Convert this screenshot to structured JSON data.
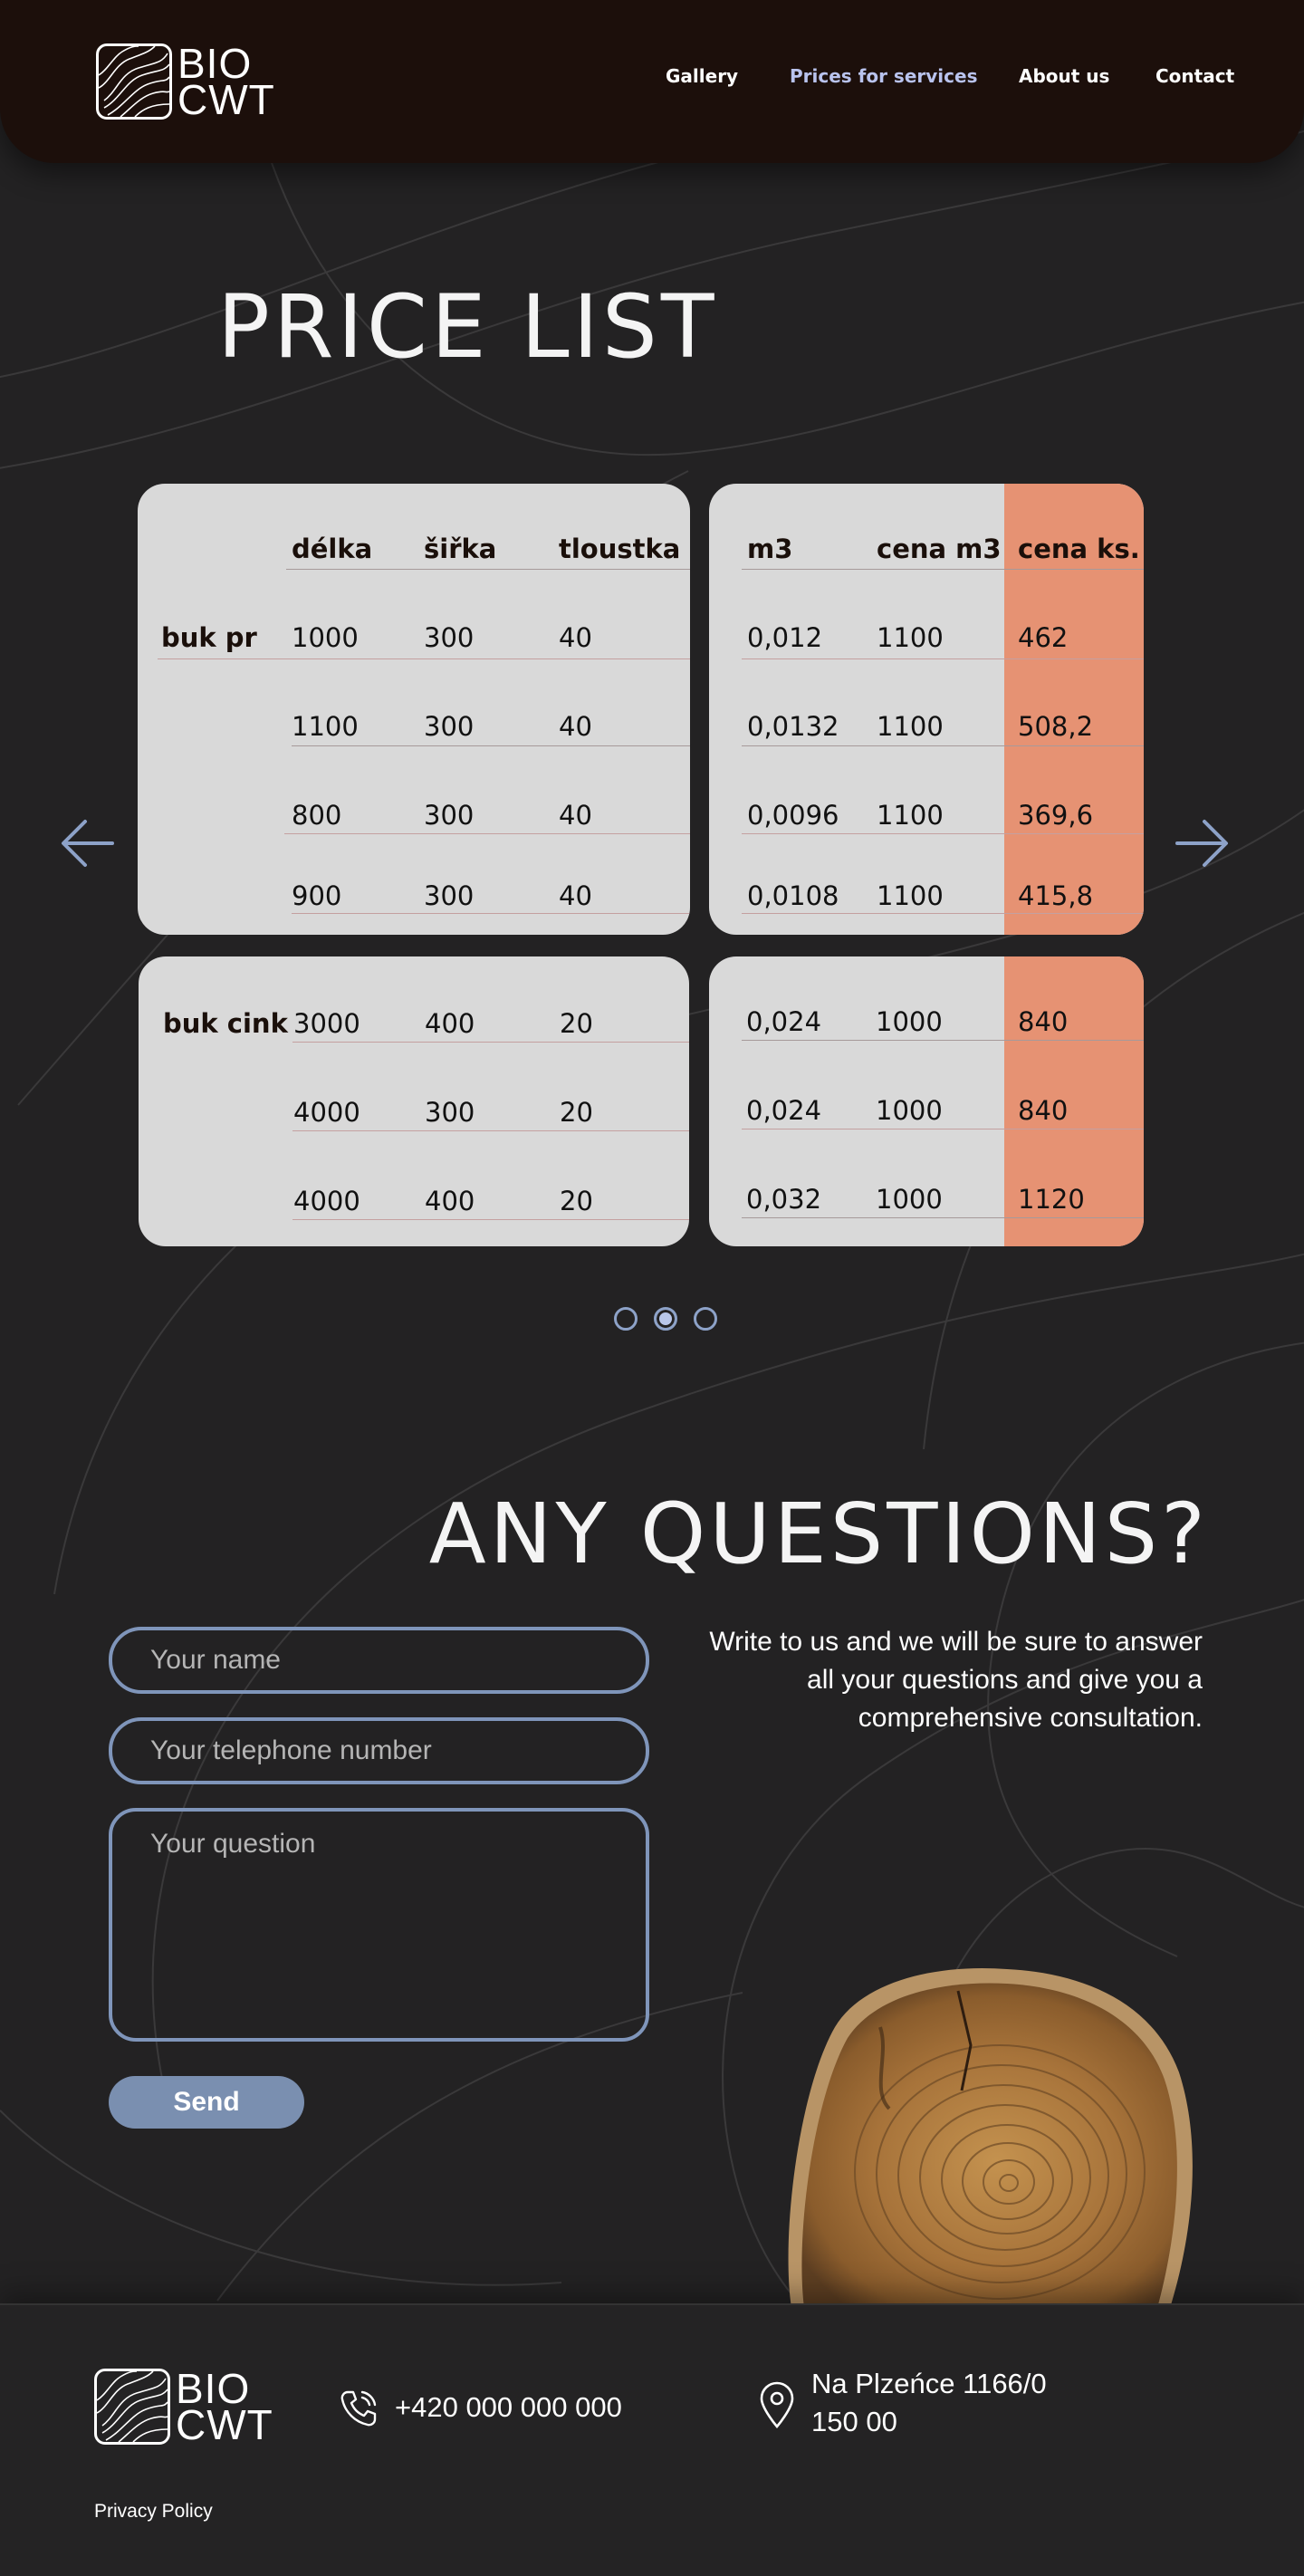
{
  "brand": {
    "line1": "BIO",
    "line2": "CWT"
  },
  "nav": [
    {
      "label": "Gallery",
      "active": false
    },
    {
      "label": "Prices for services",
      "active": true
    },
    {
      "label": "About us",
      "active": false
    },
    {
      "label": "Contact",
      "active": false
    }
  ],
  "price_list": {
    "title": "PRICE LIST",
    "headers_left": [
      "délka",
      "šiřka",
      "tloustka"
    ],
    "headers_right": [
      "m3",
      "cena m3",
      "cena ks."
    ],
    "groups": [
      {
        "name": "buk pr",
        "rows": [
          {
            "delka": "1000",
            "sirka": "300",
            "tloustka": "40",
            "m3": "0,012",
            "cena_m3": "1100",
            "cena_ks": "462"
          },
          {
            "delka": "1100",
            "sirka": "300",
            "tloustka": "40",
            "m3": "0,0132",
            "cena_m3": "1100",
            "cena_ks": "508,2"
          },
          {
            "delka": "800",
            "sirka": "300",
            "tloustka": "40",
            "m3": "0,0096",
            "cena_m3": "1100",
            "cena_ks": "369,6"
          },
          {
            "delka": "900",
            "sirka": "300",
            "tloustka": "40",
            "m3": "0,0108",
            "cena_m3": "1100",
            "cena_ks": "415,8"
          }
        ]
      },
      {
        "name": "buk cink",
        "rows": [
          {
            "delka": "3000",
            "sirka": "400",
            "tloustka": "20",
            "m3": "0,024",
            "cena_m3": "1000",
            "cena_ks": "840"
          },
          {
            "delka": "4000",
            "sirka": "300",
            "tloustka": "20",
            "m3": "0,024",
            "cena_m3": "1000",
            "cena_ks": "840"
          },
          {
            "delka": "4000",
            "sirka": "400",
            "tloustka": "20",
            "m3": "0,032",
            "cena_m3": "1000",
            "cena_ks": "1120"
          }
        ]
      }
    ],
    "carousel": {
      "slides": 3,
      "active_index": 1
    }
  },
  "questions": {
    "title": "ANY QUESTIONS?",
    "description": "Write to us and we will be sure to answer all your questions and give you a comprehensive consultation.",
    "name_placeholder": "Your name",
    "phone_placeholder": "Your telephone number",
    "question_placeholder": "Your question",
    "send_label": "Send"
  },
  "footer": {
    "phone": "+420 000 000 000",
    "address_line1": "Na Plzeńce 1166/0",
    "address_line2": "150 00",
    "privacy": "Privacy Policy"
  },
  "colors": {
    "header_bg": "#1c0f0b",
    "page_bg": "#232223",
    "card_bg": "#d9d9d9",
    "accent_column": "#e69273",
    "nav_active": "#b9c3ee",
    "button": "#7a8fb0",
    "field_border": "#7f95ba"
  },
  "icons": [
    "logo-mark-icon",
    "arrow-left-icon",
    "arrow-right-icon",
    "phone-icon",
    "location-pin-icon"
  ]
}
